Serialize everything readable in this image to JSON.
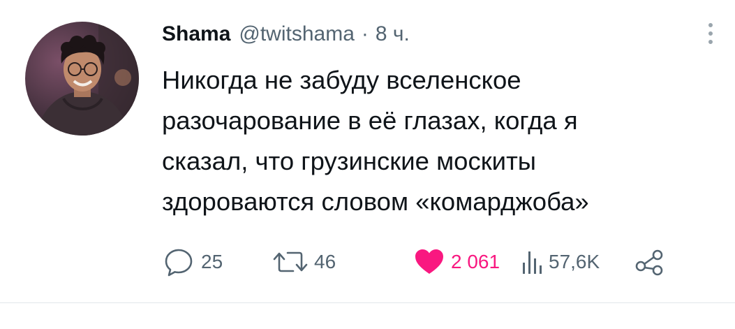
{
  "tweet": {
    "author_name": "Shama",
    "author_handle": "@twitshama",
    "separator": "·",
    "time": "8 ч.",
    "text_lines": [
      "Никогда не забуду вселенское",
      "разочарование в её глазах, когда я",
      "сказал, что грузинские москиты",
      "здороваются словом «комарджоба»"
    ]
  },
  "actions": {
    "replies": "25",
    "retweets": "46",
    "likes": "2 061",
    "views": "57,6K"
  },
  "icons": {
    "reply": "reply-icon",
    "retweet": "retweet-icon",
    "like": "heart-icon",
    "views": "views-icon",
    "share": "share-icon",
    "more": "more-vertical-icon"
  },
  "colors": {
    "text": "#0f1419",
    "secondary": "#536471",
    "like": "#f91880"
  }
}
